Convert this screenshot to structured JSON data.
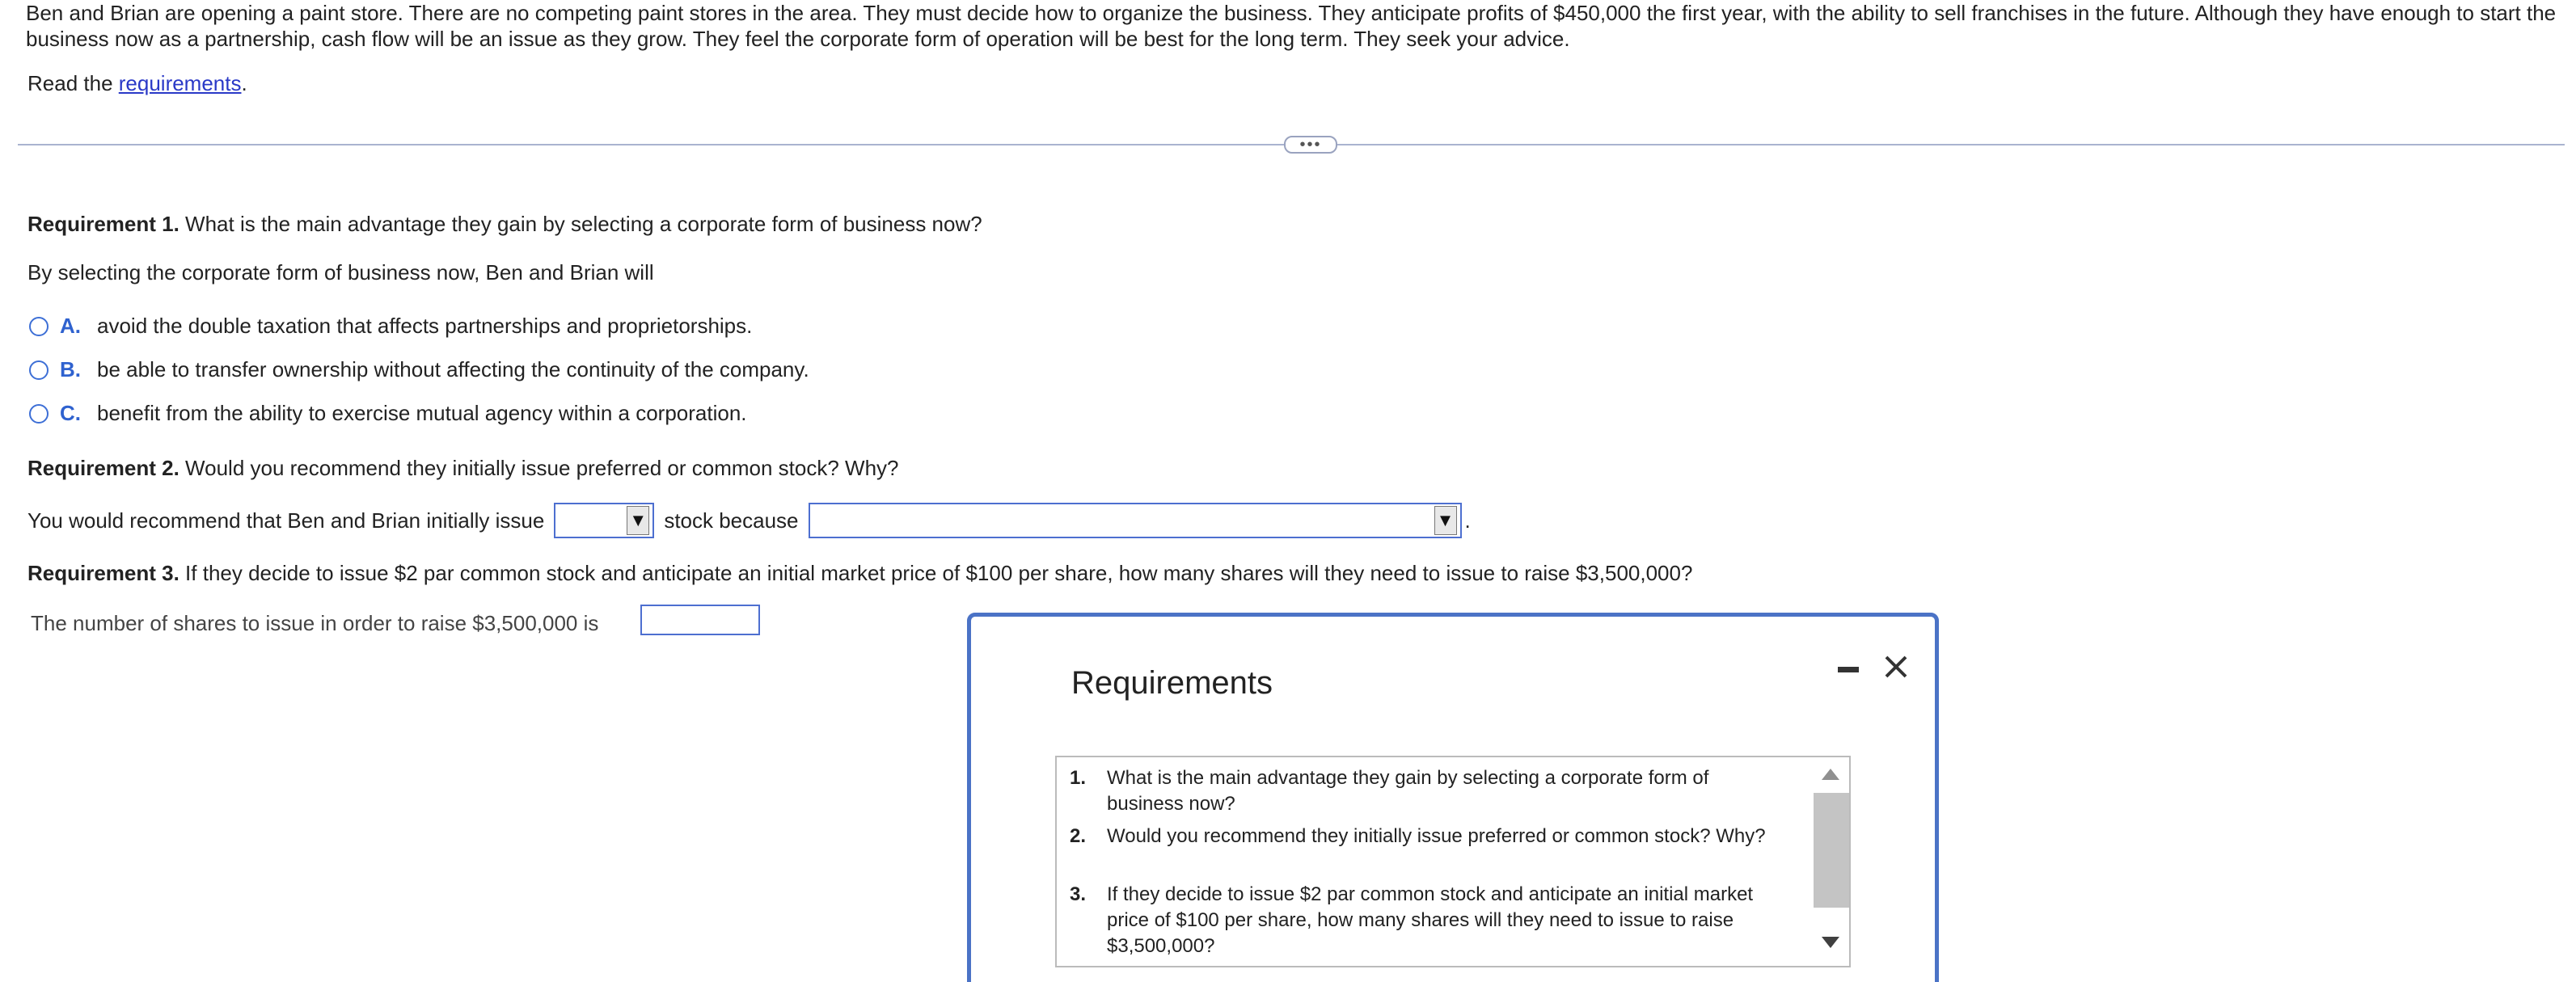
{
  "intro": {
    "text": "Ben and Brian are opening a paint store. There are no competing paint stores in the area. They must decide how to organize the business. They anticipate profits of $450,000 the first year, with the ability to sell franchises in the future. Although they have enough to start the business now as a partnership, cash flow will be an issue as they grow. They feel the corporate form of operation will be best for the long term. They seek your advice.",
    "read_prefix": "Read the ",
    "read_link": "requirements",
    "read_suffix": "."
  },
  "expand_label": "•••",
  "requirement1": {
    "label": "Requirement 1.",
    "question": " What is the main advantage they gain by selecting a corporate form of business now?",
    "prompt": "By selecting the corporate form of business now, Ben and Brian will",
    "options": [
      {
        "letter": "A.",
        "text": "avoid the double taxation that affects partnerships and proprietorships."
      },
      {
        "letter": "B.",
        "text": "be able to transfer ownership without affecting the continuity of the company."
      },
      {
        "letter": "C.",
        "text": "benefit from the ability to exercise mutual agency within a corporation."
      }
    ]
  },
  "requirement2": {
    "label": "Requirement 2.",
    "question": " Would you recommend they initially issue preferred or common stock? Why?",
    "prefix": "You would recommend that Ben and Brian initially issue",
    "middle": "stock because",
    "suffix": ".",
    "stock_selected": "",
    "reason_selected": "",
    "arrow": "▼"
  },
  "requirement3": {
    "label": "Requirement 3.",
    "question": " If they decide to issue $2 par common stock and anticipate an initial market price of $100 per share, how many shares will they need to issue to raise $3,500,000?",
    "answer_label": "The number of shares to issue in order to raise $3,500,000 is",
    "answer_value": ""
  },
  "modal": {
    "title": "Requirements",
    "items": [
      {
        "num": "1.",
        "text": "What is the main advantage they gain by selecting a corporate form of business now?"
      },
      {
        "num": "2.",
        "text": "Would you recommend they initially issue preferred or common stock? Why?"
      },
      {
        "num": "3.",
        "text": "If they decide to issue $2 par common stock and anticipate an initial market price of $100 per share, how many shares will they need to issue to raise $3,500,000?"
      }
    ]
  }
}
